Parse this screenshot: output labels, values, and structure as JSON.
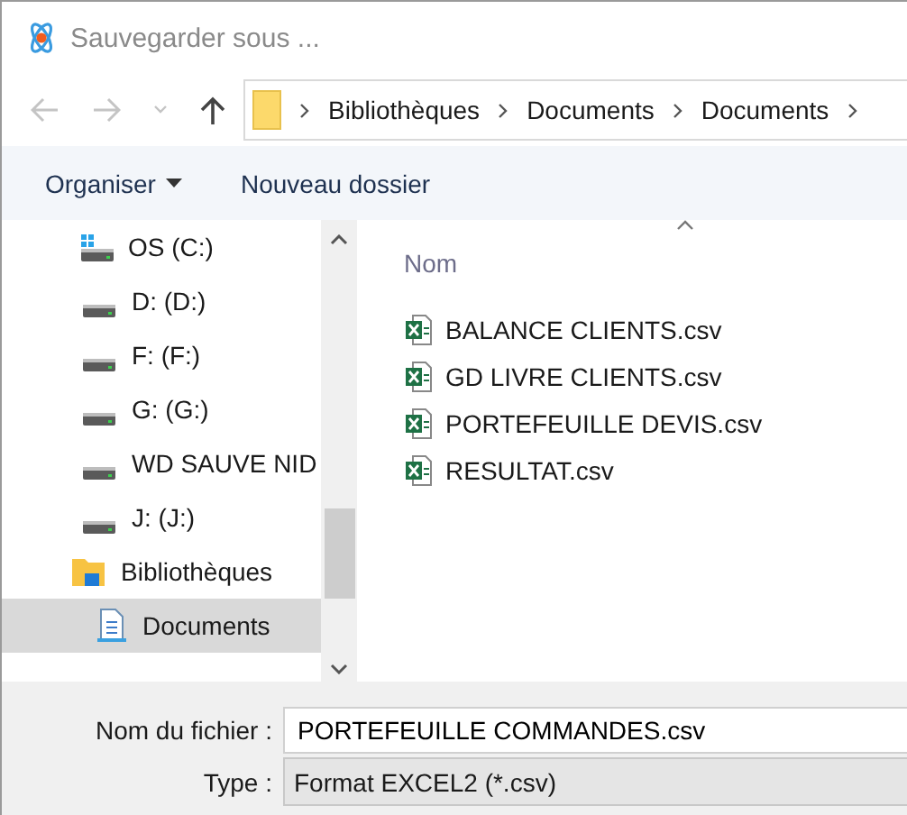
{
  "window": {
    "title": "Sauvegarder sous ..."
  },
  "breadcrumb": [
    "Bibliothèques",
    "Documents",
    "Documents"
  ],
  "toolbar": {
    "organize": "Organiser",
    "new_folder": "Nouveau dossier"
  },
  "sidebar": {
    "items": [
      {
        "label": "OS (C:)",
        "kind": "os-drive",
        "selected": false
      },
      {
        "label": "D: (D:)",
        "kind": "drive",
        "selected": false
      },
      {
        "label": "F: (F:)",
        "kind": "drive",
        "selected": false
      },
      {
        "label": "G: (G:)",
        "kind": "drive",
        "selected": false
      },
      {
        "label": "WD SAUVE NID",
        "kind": "drive",
        "selected": false
      },
      {
        "label": "J: (J:)",
        "kind": "drive",
        "selected": false
      },
      {
        "label": "Bibliothèques",
        "kind": "library",
        "selected": false,
        "children": [
          {
            "label": "Documents",
            "kind": "documents",
            "selected": true
          }
        ]
      }
    ]
  },
  "file_list": {
    "column": "Nom",
    "files": [
      "BALANCE CLIENTS.csv",
      "GD LIVRE CLIENTS.csv",
      "PORTEFEUILLE DEVIS.csv",
      "RESULTAT.csv"
    ]
  },
  "form": {
    "filename_label": "Nom du fichier :",
    "filename": "PORTEFEUILLE COMMANDES.csv",
    "type_label": "Type :",
    "type": "Format EXCEL2 (*.csv)"
  }
}
